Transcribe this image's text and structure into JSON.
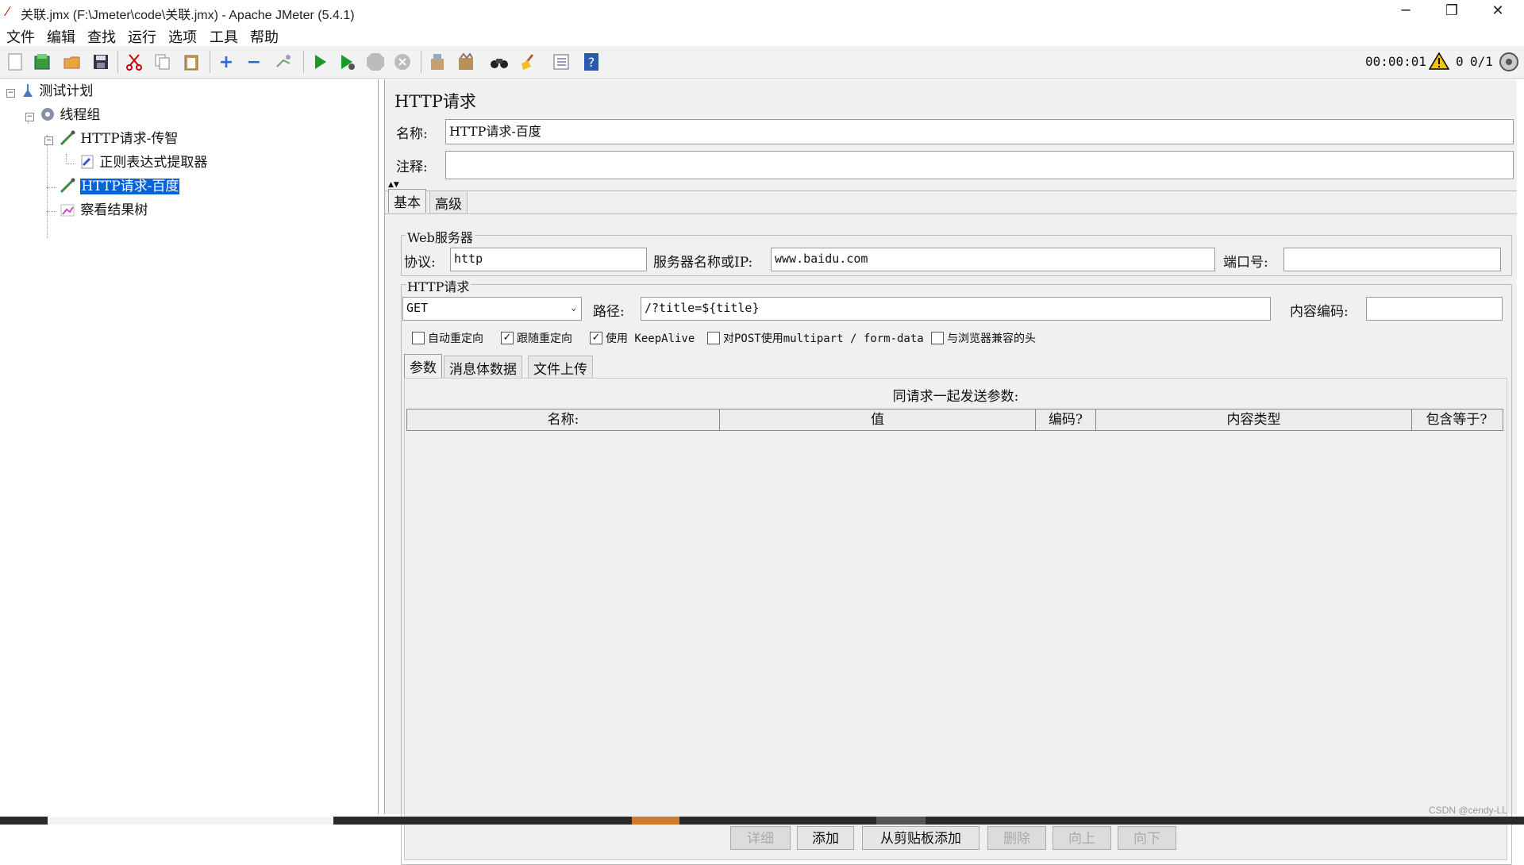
{
  "window": {
    "title": "关联.jmx (F:\\Jmeter\\code\\关联.jmx) - Apache JMeter (5.4.1)",
    "minimize": "─",
    "restore": "❐",
    "close": "✕"
  },
  "menu": [
    "文件",
    "编辑",
    "查找",
    "运行",
    "选项",
    "工具",
    "帮助"
  ],
  "status": {
    "timer": "00:00:01",
    "warnings": "0",
    "threads": "0/1"
  },
  "tree": {
    "items": [
      {
        "label": "测试计划",
        "icon": "test-plan-icon"
      },
      {
        "label": "线程组",
        "icon": "thread-group-gear-icon"
      },
      {
        "label": "HTTP请求-传智",
        "icon": "http-sampler-pipette-icon"
      },
      {
        "label": "正则表达式提取器",
        "icon": "regex-extractor-icon"
      },
      {
        "label": "HTTP请求-百度",
        "icon": "http-sampler-pipette-icon"
      },
      {
        "label": "察看结果树",
        "icon": "result-tree-icon"
      }
    ]
  },
  "panel": {
    "heading": "HTTP请求",
    "name_label": "名称:",
    "name_value": "HTTP请求-百度",
    "comment_label": "注释:",
    "comment_value": "",
    "tabs": [
      "基本",
      "高级"
    ],
    "web_server": {
      "legend": "Web服务器",
      "protocol_label": "协议:",
      "protocol_value": "http",
      "server_label": "服务器名称或IP:",
      "server_value": "www.baidu.com",
      "port_label": "端口号:",
      "port_value": ""
    },
    "http_request": {
      "legend": "HTTP请求",
      "method": "GET",
      "path_label": "路径:",
      "path_value": "/?title=${title}",
      "encoding_label": "内容编码:",
      "encoding_value": ""
    },
    "checkboxes": [
      {
        "label": "自动重定向",
        "checked": false
      },
      {
        "label": "跟随重定向",
        "checked": true
      },
      {
        "label": "使用 KeepAlive",
        "checked": true
      },
      {
        "label": "对POST使用multipart / form-data",
        "checked": false
      },
      {
        "label": "与浏览器兼容的头",
        "checked": false
      }
    ],
    "subtabs": [
      "参数",
      "消息体数据",
      "文件上传"
    ],
    "params_caption": "同请求一起发送参数:",
    "columns": [
      "名称:",
      "值",
      "编码?",
      "内容类型",
      "包含等于?"
    ],
    "buttons": [
      {
        "label": "详细",
        "enabled": false
      },
      {
        "label": "添加",
        "enabled": true
      },
      {
        "label": "从剪贴板添加",
        "enabled": true
      },
      {
        "label": "删除",
        "enabled": false
      },
      {
        "label": "向上",
        "enabled": false
      },
      {
        "label": "向下",
        "enabled": false
      }
    ]
  },
  "watermark": "CSDN @cendy-LL",
  "colors": {
    "selection": "#0a63d6",
    "panel_bg": "#f0f0f0",
    "run_green": "#1a9a2a"
  }
}
